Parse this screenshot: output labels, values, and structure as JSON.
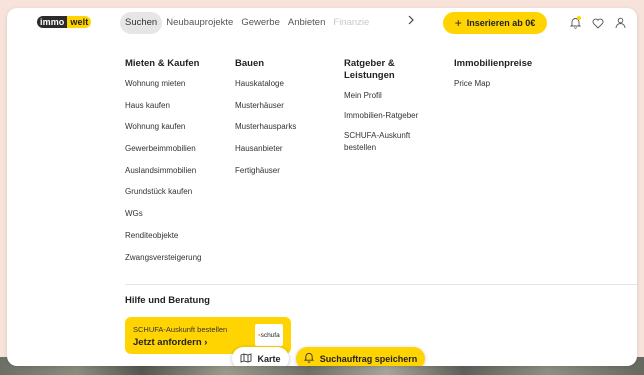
{
  "brand": {
    "part1": "immo",
    "part2": "welt",
    "accent": "#ffd400"
  },
  "nav": {
    "items": [
      {
        "label": "Suchen",
        "active": true
      },
      {
        "label": "Neubauprojekte"
      },
      {
        "label": "Gewerbe"
      },
      {
        "label": "Anbieten"
      },
      {
        "label": "Finanzie"
      }
    ],
    "more_icon": "chevron-right-icon",
    "insert_button": "Inserieren ab 0€",
    "icons": [
      "bell-icon",
      "heart-icon",
      "user-icon"
    ]
  },
  "menu": {
    "col1": {
      "title": "Mieten & Kaufen",
      "items": [
        "Wohnung mieten",
        "Haus kaufen",
        "Wohnung kaufen",
        "Gewerbeimmobilien",
        "Auslandsimmobilien",
        "Grundstück kaufen",
        "WGs",
        "Renditeobjekte",
        "Zwangsversteigerung"
      ]
    },
    "col2": {
      "title": "Bauen",
      "items": [
        "Hauskataloge",
        "Musterhäuser",
        "Musterhausparks",
        "Hausanbieter",
        "Fertighäuser"
      ]
    },
    "col3": {
      "title_line1": "Ratgeber &",
      "title_line2": "Leistungen",
      "items": [
        "Mein Profil",
        "Immobilien-Ratgeber"
      ],
      "multi_line_item": [
        "SCHUFA-Auskunft",
        "bestellen"
      ]
    },
    "col4": {
      "title": "Immobilienpreise",
      "items": [
        "Price Map"
      ]
    }
  },
  "help": {
    "title": "Hilfe und Beratung",
    "card_line1": "SCHUFA-Auskunft bestellen",
    "card_line2": "Jetzt anfordern",
    "card_logo": "schufa"
  },
  "floating": {
    "map_button": "Karte",
    "save_search_button": "Suchauftrag speichern"
  }
}
